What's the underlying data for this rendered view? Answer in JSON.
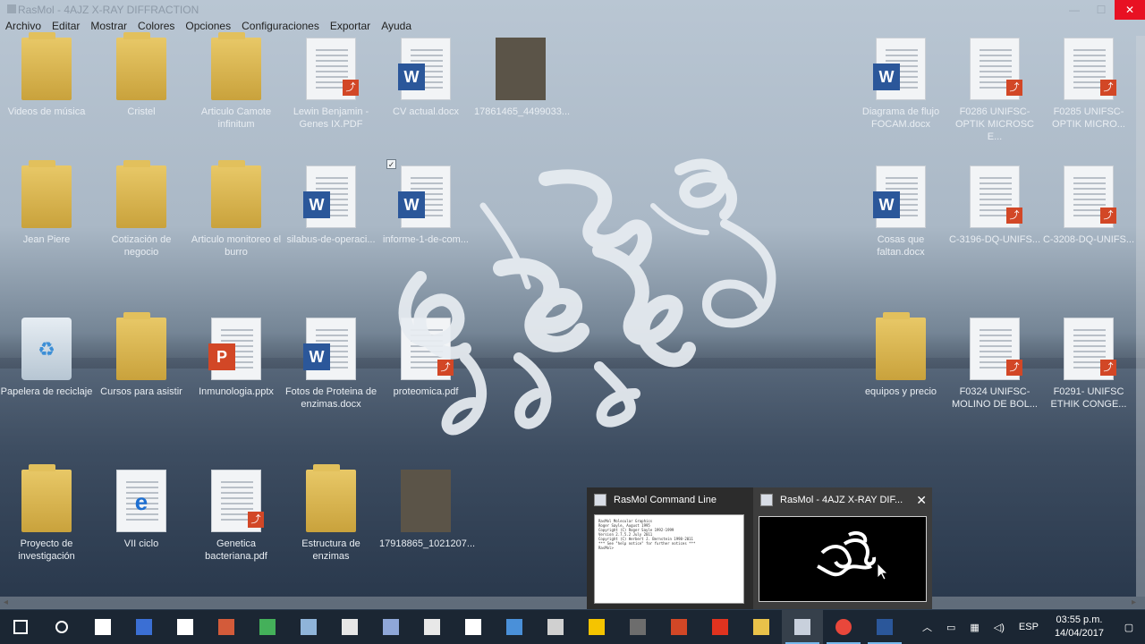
{
  "window": {
    "title": "RasMol - 4AJZ X-RAY DIFFRACTION",
    "minimize": "—",
    "maximize": "☐",
    "close": "✕"
  },
  "menu": [
    "Archivo",
    "Editar",
    "Mostrar",
    "Colores",
    "Opciones",
    "Configuraciones",
    "Exportar",
    "Ayuda"
  ],
  "desktop_icons": [
    {
      "label": "Videos de música",
      "type": "folder"
    },
    {
      "label": "Cristel",
      "type": "folder"
    },
    {
      "label": "Articulo Camote infinitum",
      "type": "folder"
    },
    {
      "label": "Lewin Benjamin - Genes IX.PDF",
      "type": "pdf"
    },
    {
      "label": "CV actual.docx",
      "type": "word"
    },
    {
      "label": "17861465_4499033...",
      "type": "photo"
    },
    {
      "label": "Diagrama de flujo FOCAM.docx",
      "type": "word"
    },
    {
      "label": "F0286 UNIFSC-OPTIK MICROSC E...",
      "type": "pdf"
    },
    {
      "label": "F0285 UNIFSC-OPTIK MICRO...",
      "type": "pdf"
    },
    {
      "label": "Jean Piere",
      "type": "folder"
    },
    {
      "label": "Cotización de negocio",
      "type": "folder"
    },
    {
      "label": "Articulo monitoreo el burro",
      "type": "folder"
    },
    {
      "label": "silabus-de-operaci...",
      "type": "word"
    },
    {
      "label": "informe-1-de-com...",
      "type": "word"
    },
    {
      "label": "Cosas que faltan.docx",
      "type": "word"
    },
    {
      "label": "C-3196-DQ-UNIFS...",
      "type": "pdf"
    },
    {
      "label": "C-3208-DQ-UNIFS...",
      "type": "pdf"
    },
    {
      "label": "Papelera de reciclaje",
      "type": "recycle"
    },
    {
      "label": "Cursos para asistir",
      "type": "folder"
    },
    {
      "label": "Inmunologia.pptx",
      "type": "ppt"
    },
    {
      "label": "Fotos de Proteina de enzimas.docx",
      "type": "word"
    },
    {
      "label": "proteomica.pdf",
      "type": "pdf"
    },
    {
      "label": "equipos y precio",
      "type": "folder"
    },
    {
      "label": "F0324 UNIFSC-MOLINO DE BOL...",
      "type": "pdf"
    },
    {
      "label": "F0291- UNIFSC ETHIK CONGE...",
      "type": "pdf"
    },
    {
      "label": "Proyecto de investigación",
      "type": "folder"
    },
    {
      "label": "VII ciclo",
      "type": "ie"
    },
    {
      "label": "Genetica bacteriana.pdf",
      "type": "pdf"
    },
    {
      "label": "Estructura de enzimas",
      "type": "folder"
    },
    {
      "label": "17918865_1021207...",
      "type": "photo"
    }
  ],
  "thumbnails": {
    "cmd_title": "RasMol Command Line",
    "cmd_text": "RasMol Molecular Graphics\nRoger Sayle, August 1995\nCopyright (C) Roger Sayle 1992-1999\nVersion 2.7.5.2 July 2011\nCopyright (C) Herbert J. Bernstein 1998-2011\n*** See \"help notice\" for further notices ***\nRasMol>",
    "mol_title": "RasMol - 4AJZ X-RAY DIF...",
    "close": "✕"
  },
  "scroll": {
    "left": "◂",
    "right": "▸"
  },
  "taskbar": {
    "items": [
      "start",
      "search",
      "task-view",
      "app1",
      "file",
      "app2",
      "app3",
      "app4",
      "app5",
      "app6",
      "app7",
      "file2",
      "app8",
      "app9",
      "app10",
      "app11",
      "powerpoint",
      "acrobat",
      "explorer",
      "rasmol",
      "chrome",
      "word"
    ],
    "tray": {
      "chevron": "︿",
      "lang": "ESP",
      "time": "03:55 p.m.",
      "date": "14/04/2017"
    }
  },
  "colors": {
    "close_red": "#e81123",
    "taskbar": "#1b2633",
    "word_blue": "#2b579a",
    "pdf_red": "#d24726"
  }
}
